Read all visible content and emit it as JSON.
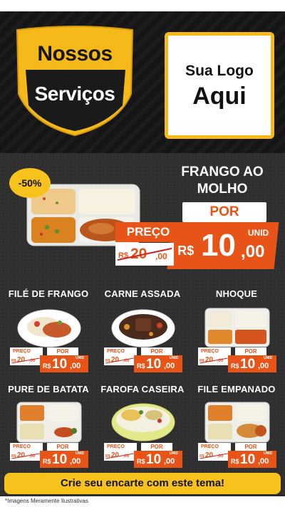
{
  "header": {
    "shield_line1": "Nossos",
    "shield_line2": "Serviços",
    "logo_line1": "Sua Logo",
    "logo_line2": "Aqui"
  },
  "featured": {
    "badge": "-50%",
    "title": "FRANGO AO MOLHO",
    "por_label": "POR",
    "preco_label": "PREÇO",
    "old_currency": "R$",
    "old_int": "20",
    "old_dec": ",00",
    "new_currency": "R$",
    "new_int": "10",
    "new_dec": ",00",
    "unit": "UNID"
  },
  "items": [
    {
      "name": "FILÉ DE FRANGO",
      "preco": "PREÇO",
      "old_cur": "R$",
      "old_int": "20",
      "old_dec": ",00",
      "por": "POR",
      "cur": "R$",
      "int": "10",
      "dec": ",00",
      "unit": "UNID"
    },
    {
      "name": "CARNE ASSADA",
      "preco": "PREÇO",
      "old_cur": "R$",
      "old_int": "20",
      "old_dec": ",00",
      "por": "POR",
      "cur": "R$",
      "int": "10",
      "dec": ",00",
      "unit": "UNID"
    },
    {
      "name": "NHOQUE",
      "preco": "PREÇO",
      "old_cur": "R$",
      "old_int": "20",
      "old_dec": ",00",
      "por": "POR",
      "cur": "R$",
      "int": "10",
      "dec": ",00",
      "unit": "UNID"
    },
    {
      "name": "PURE DE BATATA",
      "preco": "PREÇO",
      "old_cur": "R$",
      "old_int": "20",
      "old_dec": ",00",
      "por": "POR",
      "cur": "R$",
      "int": "10",
      "dec": ",00",
      "unit": "UNID"
    },
    {
      "name": "FAROFA CASEIRA",
      "preco": "PREÇO",
      "old_cur": "R$",
      "old_int": "20",
      "old_dec": ",00",
      "por": "POR",
      "cur": "R$",
      "int": "10",
      "dec": ",00",
      "unit": "UNID"
    },
    {
      "name": "FILE EMPANADO",
      "preco": "PREÇO",
      "old_cur": "R$",
      "old_int": "20",
      "old_dec": ",00",
      "por": "POR",
      "cur": "R$",
      "int": "10",
      "dec": ",00",
      "unit": "UNID"
    }
  ],
  "cta": "Crie seu encarte com este tema!",
  "footer_note": "*Imagens Meramente Ilustrativas",
  "colors": {
    "accent": "#e85417",
    "yellow": "#f6b91a",
    "board": "#2f2f2f"
  }
}
